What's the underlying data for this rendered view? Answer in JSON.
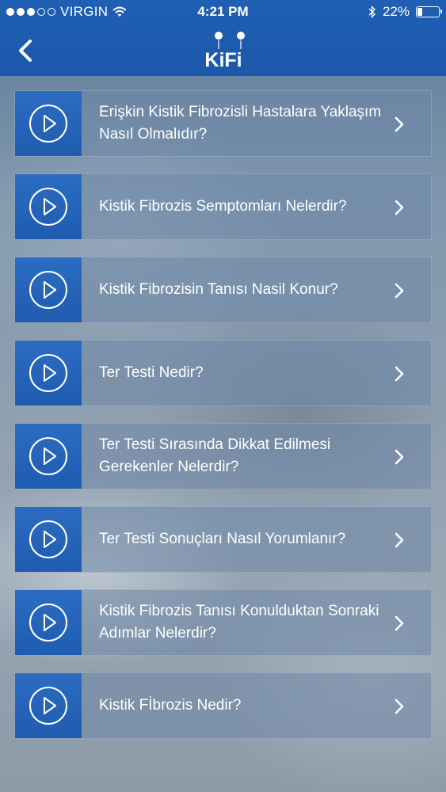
{
  "status_bar": {
    "carrier": "VIRGIN",
    "time": "4:21 PM",
    "battery": "22%",
    "battery_level": 0.22
  },
  "header": {
    "logo_text": "KiFi",
    "back_icon": "chevron-left-icon"
  },
  "colors": {
    "header_blue": "#1f5fb4",
    "thumb_blue": "#2b6cc2",
    "text": "#ffffff"
  },
  "videos": [
    {
      "title": "Erişkin Kistik Fibrozisli Hastalara Yaklaşım Nasıl Olmalıdır?",
      "icon": "play-circle-icon"
    },
    {
      "title": "Kistik Fibrozis Semptomları Nelerdir?",
      "icon": "play-circle-icon"
    },
    {
      "title": "Kistik Fibrozisin Tanısı Nasil Konur?",
      "icon": "play-circle-icon"
    },
    {
      "title": "Ter Testi Nedir?",
      "icon": "play-circle-icon"
    },
    {
      "title": "Ter Testi Sırasında Dikkat Edilmesi Gerekenler Nelerdir?",
      "icon": "play-circle-icon"
    },
    {
      "title": "Ter Testi Sonuçları Nasıl Yorumlanır?",
      "icon": "play-circle-icon"
    },
    {
      "title": "Kistik Fibrozis Tanısı Konulduktan Sonraki Adımlar Nelerdir?",
      "icon": "play-circle-icon"
    },
    {
      "title": "Kistik Fİbrozis Nedir?",
      "icon": "play-circle-icon"
    }
  ]
}
